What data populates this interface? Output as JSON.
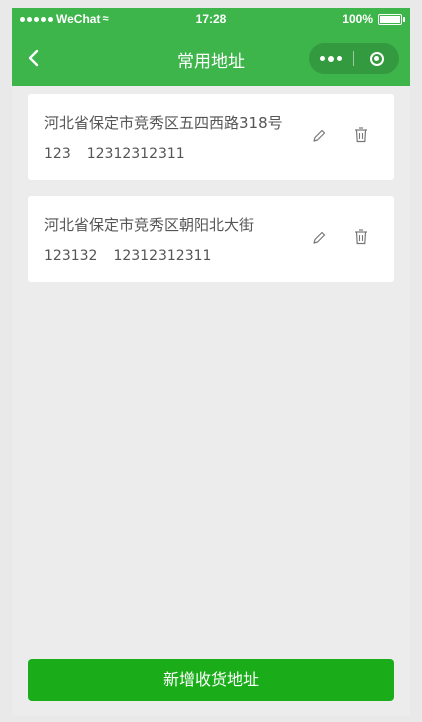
{
  "status_bar": {
    "carrier": "WeChat",
    "time": "17:28",
    "battery": "100%"
  },
  "nav": {
    "title": "常用地址"
  },
  "addresses": [
    {
      "address": "河北省保定市竞秀区五四西路318号",
      "name": "123",
      "phone": "12312312311"
    },
    {
      "address": "河北省保定市竞秀区朝阳北大街",
      "name": "123132",
      "phone": "12312312311"
    }
  ],
  "footer": {
    "add_label": "新增收货地址"
  },
  "colors": {
    "nav_green": "#3db54b",
    "button_green": "#1aad19",
    "background": "#ececec"
  },
  "icons": [
    "back-arrow-icon",
    "more-menu-icon",
    "close-mini-program-icon",
    "edit-pencil-icon",
    "trash-icon",
    "wifi-icon",
    "battery-icon"
  ]
}
